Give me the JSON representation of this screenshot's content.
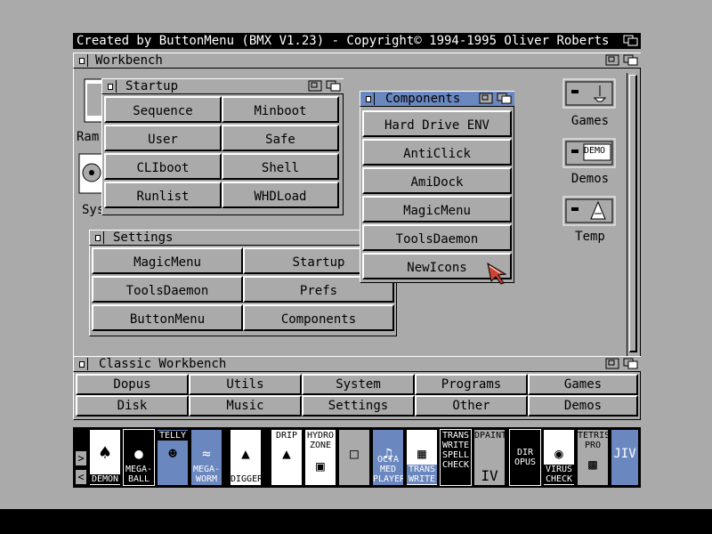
{
  "screen": {
    "title": "Created by ButtonMenu (BMX V1.23) - Copyright© 1994-1995 Oliver Roberts"
  },
  "workbench": {
    "title": "Workbench",
    "icons": {
      "ram_label": "Ram",
      "system_label": "System",
      "games_label": "Games",
      "demos_label": "Demos",
      "demos_badge": "DEMO",
      "temp_label": "Temp"
    }
  },
  "startup": {
    "title": "Startup",
    "buttons": [
      "Sequence",
      "Minboot",
      "User",
      "Safe",
      "CLIboot",
      "Shell",
      "Runlist",
      "WHDLoad"
    ]
  },
  "components": {
    "title": "Components",
    "buttons": [
      "Hard Drive ENV",
      "AntiClick",
      "AmiDock",
      "MagicMenu",
      "ToolsDaemon",
      "NewIcons"
    ]
  },
  "settings": {
    "title": "Settings",
    "buttons": [
      "MagicMenu",
      "Startup",
      "ToolsDaemon",
      "Prefs",
      "ButtonMenu",
      "Components"
    ]
  },
  "classic": {
    "title": "Classic Workbench",
    "buttons": [
      "Dopus",
      "Utils",
      "System",
      "Programs",
      "Games",
      "Disk",
      "Music",
      "Settings",
      "Other",
      "Demos"
    ]
  },
  "dock": {
    "arrows": [
      ">",
      "<"
    ],
    "tiles": [
      {
        "top": "",
        "caption": "DEMON",
        "icon": "spade-card-icon"
      },
      {
        "top": "",
        "caption": "MEGA-BALL",
        "icon": "megaball-icon"
      },
      {
        "top": "TELLY",
        "caption": "",
        "icon": "telly-icon"
      },
      {
        "top": "",
        "caption": "MEGA-WORM",
        "icon": "megaworm-icon"
      },
      {
        "top": "",
        "caption": "DIGGER",
        "icon": "digger-icon"
      },
      {
        "top": "DRIP",
        "caption": "",
        "icon": "drip-icon"
      },
      {
        "top": "HYDRO ZONE",
        "caption": "",
        "icon": "hydrozone-icon"
      },
      {
        "top": "",
        "caption": "",
        "icon": "window-icon"
      },
      {
        "top": "",
        "caption": "OCTA MED PLAYER",
        "icon": "octamed-icon"
      },
      {
        "top": "",
        "caption": "TRANS WRITE",
        "icon": "transwrite-icon"
      },
      {
        "top": "TRANS WRITE SPELL CHECK",
        "caption": "",
        "icon": "spellcheck-icon"
      },
      {
        "top": "DPAINT",
        "caption": "IV",
        "icon": "dpaint-icon"
      },
      {
        "top": "",
        "caption": "DIR OPUS",
        "icon": "diropus-icon"
      },
      {
        "top": "",
        "caption": "VIRUS CHECK",
        "icon": "viruscheck-icon"
      },
      {
        "top": "TETRIS PRO",
        "caption": "",
        "icon": "tetris-icon"
      },
      {
        "top": "",
        "caption": "JIV",
        "icon": "jiv-icon"
      }
    ]
  },
  "colors": {
    "workbench_gray": "#aaaaaa",
    "active_title_blue": "#6b87c0",
    "pointer_red": "#cc4433"
  }
}
